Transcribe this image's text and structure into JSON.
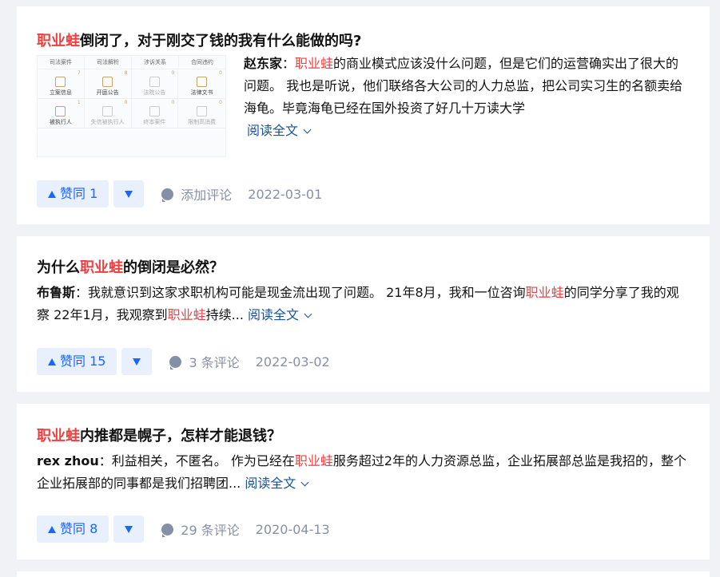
{
  "cards": [
    {
      "title_hl": "职业蛙",
      "title_rest": "倒闭了，对于刚交了钱的我有什么能做的吗?",
      "author": "赵东家",
      "sep": "：",
      "excerpt_hl": "职业蛙",
      "excerpt_rest": "的商业模式应该没什么问题，但是它们的运营确实出了很大的问题。 我也是听说，他们联络各大公司的人力总监，把公司实习生的名额卖给海龟。毕竟海龟已经在国外投资了好几十万读大学",
      "read_more": "阅读全文",
      "vote_label": "赞同 1",
      "comment_label": "添加评论",
      "date": "2022-03-01",
      "thumbnail": {
        "tabs": [
          "司法案件",
          "司法解析",
          "涉诉关系",
          "合同违约"
        ],
        "cells": [
          {
            "label": "立案信息",
            "num": "7"
          },
          {
            "label": "开庭公告",
            "num": "8"
          },
          {
            "label": "法院公告",
            "num": "0"
          },
          {
            "label": "法律文书",
            "num": "0"
          },
          {
            "label": "被执行人",
            "num": "1"
          },
          {
            "label": "失信被执行人",
            "num": "0"
          },
          {
            "label": "终本案件",
            "num": "0"
          },
          {
            "label": "限制高消费",
            "num": "0"
          }
        ]
      }
    },
    {
      "title_hl": "职业蛙",
      "title_pre": "为什么",
      "title_rest": "的倒闭是必然？",
      "author": "布鲁斯",
      "sep": "：",
      "excerpt_a": "我就意识到这家求职机构可能是现金流出现了问题。 21年8月，我和一位咨询",
      "excerpt_hl1": "职业蛙",
      "excerpt_b": "的同学分享了我的观察 22年1月，我观察到",
      "excerpt_hl2": "职业蛙",
      "excerpt_c": "持续...",
      "read_more": "阅读全文",
      "vote_label": "赞同 15",
      "comment_label": "3 条评论",
      "date": "2022-03-02"
    },
    {
      "title_hl": "职业蛙",
      "title_rest": "内推都是幌子，怎样才能退钱？",
      "author": "rex zhou",
      "sep": "：",
      "excerpt_a": "利益相关，不匿名。 作为已经在",
      "excerpt_hl1": "职业蛙",
      "excerpt_b": "服务超过2年的人力资源总监，企业拓展部总监是我招的，整个企业拓展部的同事都是我们招聘团...",
      "read_more": "阅读全文",
      "vote_label": "赞同 8",
      "comment_label": "29 条评论",
      "date": "2020-04-13"
    }
  ]
}
